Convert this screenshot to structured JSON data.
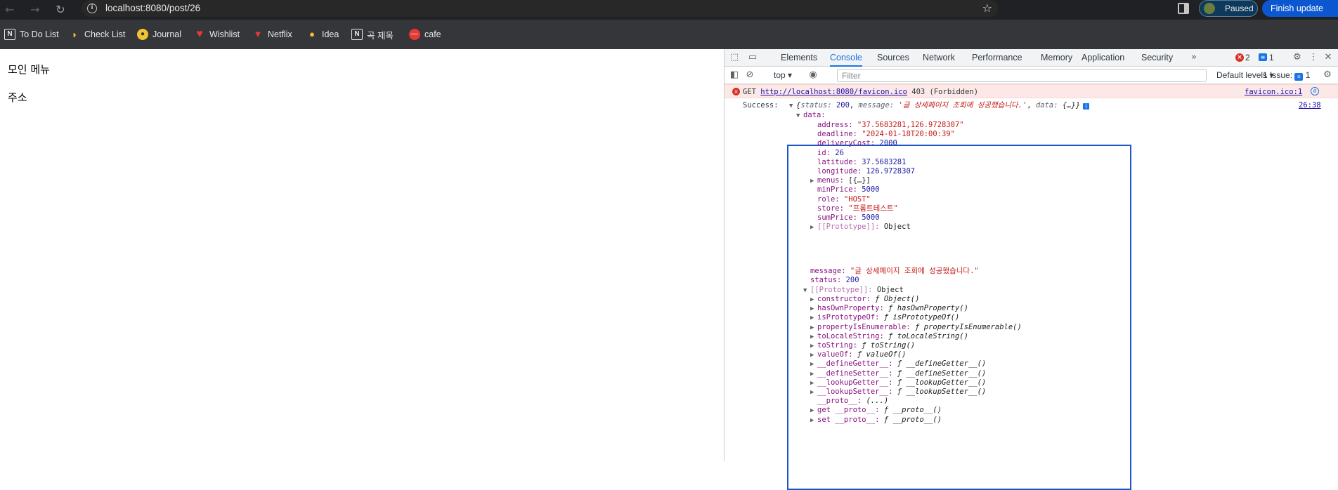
{
  "browser": {
    "url": "localhost:8080/post/26",
    "paused_label": "Paused",
    "finish_update_label": "Finish update"
  },
  "bookmarks": [
    {
      "label": "To Do List",
      "icon": "notion-icon"
    },
    {
      "label": "Check List",
      "icon": "banana-icon"
    },
    {
      "label": "Journal",
      "icon": "journal-icon"
    },
    {
      "label": "Wishlist",
      "icon": "heart-icon"
    },
    {
      "label": "Netflix",
      "icon": "popcorn-icon"
    },
    {
      "label": "Idea",
      "icon": "lightbulb-icon"
    },
    {
      "label": "곡 제목",
      "icon": "notion-icon"
    },
    {
      "label": "cafe",
      "icon": "cafe-icon"
    }
  ],
  "page": {
    "heading": "모인 메뉴",
    "address_label": "주소"
  },
  "devtools": {
    "tabs": [
      "Elements",
      "Console",
      "Sources",
      "Network",
      "Performance",
      "Memory",
      "Application",
      "Security"
    ],
    "active_tab": "Console",
    "error_count": "2",
    "message_count": "1",
    "context": "top",
    "filter_placeholder": "Filter",
    "levels": "Default levels",
    "issues_label": "1 Issue:",
    "issues_count": "1"
  },
  "console": {
    "error": {
      "method": "GET",
      "url": "http://localhost:8080/favicon.ico",
      "status": "403 (Forbidden)",
      "source": "favicon.ico:1"
    },
    "log": {
      "prefix": "Success:",
      "source": "26:38",
      "summary_open": "{",
      "summary_status_key": "status:",
      "summary_status_val": "200",
      "summary_message_key": "message:",
      "summary_message_val": "'글 상세페이지 조회에 성공했습니다.'",
      "summary_data_key": "data:",
      "summary_data_val": "{…}}",
      "data_key": "data:",
      "fields": [
        {
          "key": "address:",
          "value": "\"37.5683281,126.9728307\"",
          "kind": "s"
        },
        {
          "key": "deadline:",
          "value": "\"2024-01-18T20:00:39\"",
          "kind": "s"
        },
        {
          "key": "deliveryCost:",
          "value": "2000",
          "kind": "n"
        },
        {
          "key": "id:",
          "value": "26",
          "kind": "n"
        },
        {
          "key": "latitude:",
          "value": "37.5683281",
          "kind": "n"
        },
        {
          "key": "longitude:",
          "value": "126.9728307",
          "kind": "n"
        },
        {
          "key": "menus:",
          "value": "[{…}]",
          "kind": "p",
          "expandable": true
        },
        {
          "key": "minPrice:",
          "value": "5000",
          "kind": "n"
        },
        {
          "key": "role:",
          "value": "\"HOST\"",
          "kind": "s"
        },
        {
          "key": "store:",
          "value": "\"프롬트테스트\"",
          "kind": "s"
        },
        {
          "key": "sumPrice:",
          "value": "5000",
          "kind": "n"
        },
        {
          "key": "[[Prototype]]:",
          "value": "Object",
          "kind": "p",
          "expandable": true,
          "dim": true
        }
      ],
      "message_key": "message:",
      "message_val": "\"글 상세페이지 조회에 성공했습니다.\"",
      "status_key": "status:",
      "status_val": "200",
      "proto_key": "[[Prototype]]:",
      "proto_val": "Object",
      "proto_members": [
        {
          "key": "constructor:",
          "value": "ƒ Object()"
        },
        {
          "key": "hasOwnProperty:",
          "value": "ƒ hasOwnProperty()"
        },
        {
          "key": "isPrototypeOf:",
          "value": "ƒ isPrototypeOf()"
        },
        {
          "key": "propertyIsEnumerable:",
          "value": "ƒ propertyIsEnumerable()"
        },
        {
          "key": "toLocaleString:",
          "value": "ƒ toLocaleString()"
        },
        {
          "key": "toString:",
          "value": "ƒ toString()"
        },
        {
          "key": "valueOf:",
          "value": "ƒ valueOf()"
        },
        {
          "key": "__defineGetter__:",
          "value": "ƒ __defineGetter__()"
        },
        {
          "key": "__defineSetter__:",
          "value": "ƒ __defineSetter__()"
        },
        {
          "key": "__lookupGetter__:",
          "value": "ƒ __lookupGetter__()"
        },
        {
          "key": "__lookupSetter__:",
          "value": "ƒ __lookupSetter__()"
        },
        {
          "key": "__proto__:",
          "value": "(...)",
          "noarrow": true
        },
        {
          "key": "get __proto__:",
          "value": "ƒ __proto__()"
        },
        {
          "key": "set __proto__:",
          "value": "ƒ __proto__()"
        }
      ]
    }
  }
}
